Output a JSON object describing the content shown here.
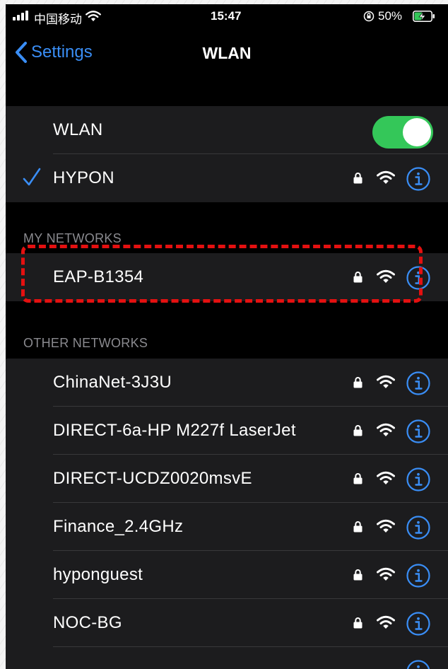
{
  "status_bar": {
    "carrier": "中国移动",
    "time": "15:47",
    "battery_percent": "50%",
    "battery_level": 0.5,
    "icons": [
      "signal-icon",
      "wifi-icon",
      "rotation-lock-icon",
      "battery-charging-icon"
    ]
  },
  "nav": {
    "back_label": "Settings",
    "title": "WLAN"
  },
  "wlan_toggle": {
    "label": "WLAN",
    "on": true
  },
  "connected_network": {
    "name": "HYPON",
    "secured": true
  },
  "my_networks": {
    "header": "MY NETWORKS",
    "items": [
      {
        "name": "EAP-B1354",
        "secured": true
      }
    ]
  },
  "other_networks": {
    "header": "OTHER NETWORKS",
    "items": [
      {
        "name": "ChinaNet-3J3U",
        "secured": true
      },
      {
        "name": "DIRECT-6a-HP M227f LaserJet",
        "secured": true
      },
      {
        "name": "DIRECT-UCDZ0020msvE",
        "secured": true
      },
      {
        "name": "Finance_2.4GHz",
        "secured": true
      },
      {
        "name": "hyponguest",
        "secured": true
      },
      {
        "name": "NOC-BG",
        "secured": true
      },
      {
        "name": "",
        "secured": false
      }
    ]
  },
  "colors": {
    "accent": "#3a8ef6",
    "toggle_on": "#34c759",
    "highlight": "#e41010",
    "cell_background": "#1c1c1e",
    "section_text": "#8a8a8f"
  }
}
